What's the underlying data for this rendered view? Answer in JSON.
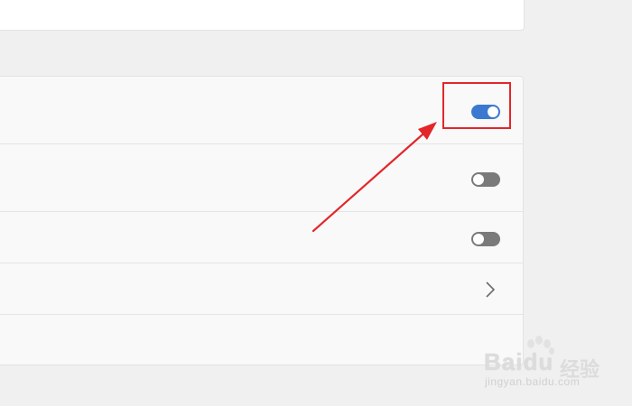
{
  "settings": {
    "rows": [
      {
        "control": "toggle",
        "state": "on"
      },
      {
        "control": "toggle",
        "state": "off"
      },
      {
        "control": "toggle",
        "state": "off"
      },
      {
        "control": "chevron",
        "icon": "chevron-right-icon"
      },
      {
        "control": "none"
      }
    ]
  },
  "annotation": {
    "highlight_color": "#e3262a",
    "arrow_color": "#e3262a"
  },
  "watermark": {
    "brand": "Bai",
    "brand_suffix": "du",
    "cn": "经验",
    "url": "jingyan.baidu.com"
  },
  "colors": {
    "toggle_on": "#3b78d0",
    "toggle_off": "#7a7a7a",
    "page_bg": "#f0f0f0",
    "card_bg": "#f9f9f9"
  }
}
